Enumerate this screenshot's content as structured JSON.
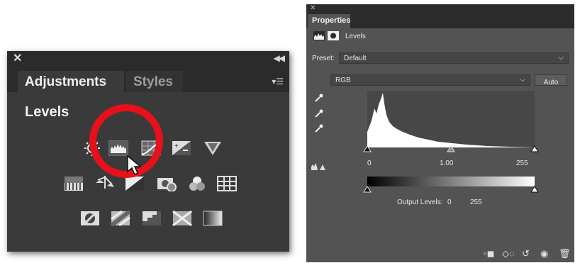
{
  "adjustments": {
    "tab_active": "Adjustments",
    "tab_inactive": "Styles",
    "section_title": "Levels",
    "icons_row1": [
      "brightness-contrast-icon",
      "levels-icon",
      "curves-icon",
      "exposure-icon",
      "vibrance-icon"
    ],
    "icons_row2": [
      "hue-saturation-icon",
      "color-balance-icon",
      "black-white-icon",
      "photo-filter-icon",
      "channel-mixer-icon",
      "color-lookup-icon"
    ],
    "icons_row3": [
      "invert-icon",
      "posterize-icon",
      "threshold-icon",
      "selective-color-icon",
      "gradient-map-icon"
    ],
    "highlight_color": "#e8101a"
  },
  "properties": {
    "tab": "Properties",
    "layer_title": "Levels",
    "preset_label": "Preset:",
    "preset_value": "Default",
    "channel_value": "RGB",
    "auto_label": "Auto",
    "input_black": "0",
    "input_gamma": "1.00",
    "input_white": "255",
    "output_label": "Output Levels:",
    "output_black": "0",
    "output_white": "255"
  }
}
